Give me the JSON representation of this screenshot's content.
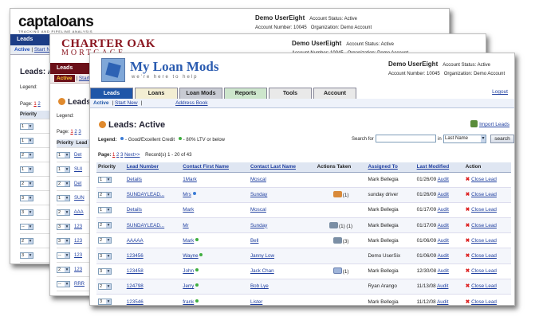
{
  "back1": {
    "logo_main": "captaloans",
    "logo_sub": "TRACKING AND PIPELINE ANALYSIS",
    "user": "Demo UserEight",
    "status": "Account Status: Active",
    "acct_no": "Account Number: 10045",
    "org": "Organization: Demo Account",
    "nav": "Leads",
    "sub_active": "Active",
    "sub_start": "Start New",
    "heading": "Leads: Active",
    "legend": "Legend:",
    "page": "Page:",
    "priority": "Priority",
    "rows": [
      "1",
      "1",
      "2",
      "1",
      "2",
      "3",
      "3",
      "--",
      "2",
      "3"
    ]
  },
  "back2": {
    "logo_main": "CHARTER OAK",
    "logo_sub": "MORTGAGE",
    "user": "Demo UserEight",
    "status": "Account Status: Active",
    "acct_no": "Account Number: 10045",
    "org": "Organization: Demo Account",
    "nav": "Leads",
    "sub_active": "Active",
    "sub_start": "Start New",
    "heading": "Leads: Active",
    "legend": "Legend:",
    "page": "Page:",
    "priority": "Priority",
    "lead_col": "Lead",
    "rows": [
      "1",
      "1",
      "2",
      "1",
      "2",
      "3",
      "3",
      "--",
      "2",
      "--"
    ],
    "lead_vals": [
      "Det",
      "SUI",
      "Det",
      "SUN",
      "AAA",
      "123",
      "123",
      "123",
      "123",
      "RRR"
    ]
  },
  "front": {
    "logo_main": "My Loan Mods",
    "logo_sub": "we're here to help",
    "user": "Demo UserEight",
    "status": "Account Status: Active",
    "acct_no": "Account Number: 10045",
    "org": "Organization: Demo Account",
    "tabs": [
      "Leads",
      "Loans",
      "Loan Mods",
      "Reports",
      "Tools",
      "Account"
    ],
    "tab_colors": [
      "#1f56a8",
      "#f3eed3",
      "#c8cbd3",
      "#cde6cc",
      "#e9e9e9",
      "#e9e9e9"
    ],
    "logout": "Logout",
    "sub_active": "Active",
    "sub_start": "Start New",
    "sub_address": "Address Book",
    "heading": "Leads: Active",
    "import": "Import Leads",
    "legend_label": "Legend:",
    "legend_good": "- Good/Excellent Credit",
    "legend_ltv": "- 80% LTV or below",
    "search_label": "Search for",
    "search_in": "in",
    "search_field": "Last Name",
    "search_btn": "search",
    "page_label": "Page:",
    "pages": [
      "1",
      "2",
      "3"
    ],
    "next": "Next>>",
    "records": "Record(s) 1 - 20 of 43",
    "columns": [
      "Priority",
      "Lead Number",
      "Contact First Name",
      "Contact Last Name",
      "Actions Taken",
      "Assigned To",
      "Last Modified",
      "Action"
    ],
    "audit": "Audit",
    "close": "Close Lead",
    "rows": [
      {
        "p": "1",
        "lead": "Details",
        "first": "1Mark",
        "last": "Moscal",
        "actions": "",
        "assigned": "Mark Bellegia",
        "mod": "01/26/09"
      },
      {
        "p": "2",
        "lead": "SUNDAYLEAD...",
        "first": "Mrs",
        "last": "Sunday",
        "actions": "(1)",
        "assigned": "sunday driver",
        "mod": "01/26/09"
      },
      {
        "p": "1",
        "lead": "Details",
        "first": "Mark",
        "last": "Moscal",
        "actions": "",
        "assigned": "Mark Bellegia",
        "mod": "01/17/09"
      },
      {
        "p": "2",
        "lead": "SUNDAYLEAD...",
        "first": "Mr",
        "last": "Sunday",
        "actions": "(1)  (1)",
        "assigned": "Mark Bellegia",
        "mod": "01/17/09"
      },
      {
        "p": "2",
        "lead": "AAAAA",
        "first": "Mark",
        "last": "Bell",
        "actions": "(3)",
        "assigned": "Mark Bellegia",
        "mod": "01/06/09"
      },
      {
        "p": "3",
        "lead": "123456",
        "first": "Wayne",
        "last": "Janny Low",
        "actions": "",
        "assigned": "Demo UserSix",
        "mod": "01/06/09"
      },
      {
        "p": "3",
        "lead": "123458",
        "first": "John",
        "last": "Jack Chan",
        "actions": "(1)",
        "assigned": "Mark Bellegia",
        "mod": "12/30/08"
      },
      {
        "p": "2",
        "lead": "124798",
        "first": "Jerry",
        "last": "Bob Lye",
        "actions": "",
        "assigned": "Ryan Arango",
        "mod": "11/13/08"
      },
      {
        "p": "3",
        "lead": "123546",
        "first": "frank",
        "last": "Lister",
        "actions": "",
        "assigned": "Mark Bellegia",
        "mod": "11/12/08"
      }
    ]
  }
}
